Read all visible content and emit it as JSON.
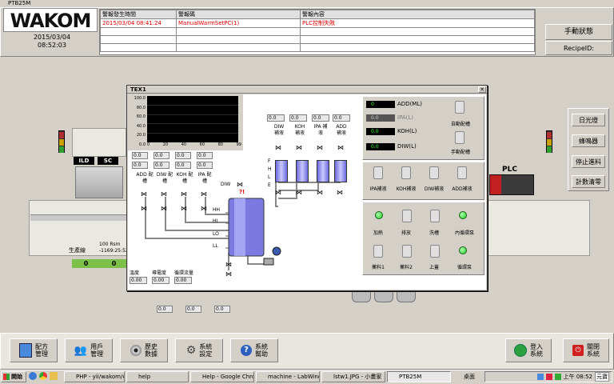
{
  "window": {
    "title": "PTB25M"
  },
  "logo": "WAKOM",
  "datetime": {
    "date": "2015/03/04",
    "time": "08:52:03"
  },
  "alarm": {
    "columns": [
      "警報發生時間",
      "警報碼",
      "警報內容"
    ],
    "rows": [
      [
        "2015/03/04 08:41:24",
        "ManualWarmSetPC(1)",
        "PLC控制失敗"
      ]
    ]
  },
  "top_right": {
    "mode": "手動狀態",
    "recipe_label": "RecipeID:"
  },
  "right_buttons": [
    "日光燈",
    "蜂鳴器",
    "停止進料",
    "計數清零"
  ],
  "plc_label": "PLC",
  "bg": {
    "ild": "ILD",
    "sc": "SC",
    "production_line": "生產線",
    "rpm": "100 Rsm",
    "rpm2": "-1169:25:52",
    "counter_a": "0",
    "counter_b": "0"
  },
  "dialog": {
    "title": "TEX1",
    "chart_ylabels": [
      "100.0",
      "80.0",
      "60.0",
      "40.0",
      "20.0",
      "0.0"
    ],
    "chart_xlabels": [
      "0",
      "20",
      "40",
      "60",
      "80",
      "99"
    ],
    "left_values": [
      "0.0",
      "0.0",
      "0.0",
      "0.0",
      "0.0",
      "0.0",
      "0.0",
      "0.0"
    ],
    "valve_labels": [
      "ADD 配槽",
      "DIW 配槽",
      "KOH 配槽",
      "IPA 配槽"
    ],
    "diw_label": "DIW",
    "top_vals": [
      "0.0",
      "0.0",
      "0.0",
      "0.0"
    ],
    "supply_labels": [
      "DIW 補液",
      "KOH 補液",
      "IPA 補液",
      "ADD 補液"
    ],
    "levels_small": [
      "F",
      "H",
      "L",
      "E"
    ],
    "levels_main": [
      "HH",
      "HI",
      "LO",
      "LL"
    ],
    "bottom_labels": [
      "溫度",
      "導電度",
      "循環流量"
    ],
    "bottom_vals": [
      "0.00",
      "0.00",
      "0.00"
    ],
    "bottom_vals2": [
      "0.0",
      "0.0",
      "0.0"
    ],
    "readouts": [
      {
        "value": "0",
        "label": "ADD(ML)"
      },
      {
        "value": "0.0",
        "label": "IPA(L)"
      },
      {
        "value": "0.0",
        "label": "KOH(L)"
      },
      {
        "value": "0.0",
        "label": "DIW(L)"
      }
    ],
    "switch_auto": "自動配槽",
    "switch_manual": "手動配槽",
    "refill_labels": [
      "IPA補液",
      "KOH補液",
      "DIW補液",
      "ADD補液"
    ],
    "controls_row1": [
      "加熱",
      "排放",
      "洗槽",
      "內循環泵"
    ],
    "controls_row2": [
      "藥料1",
      "藥料2",
      "上蓋",
      "循環泵"
    ],
    "led_colors": {
      "on": "#22cc22",
      "off": "#c8c8c8"
    }
  },
  "toolbar": [
    {
      "label": "配方\n管理",
      "icon": "recipe-icon"
    },
    {
      "label": "用戶\n管理",
      "icon": "users-icon"
    },
    {
      "label": "歷史\n數據",
      "icon": "history-icon"
    },
    {
      "label": "系統\n設定",
      "icon": "settings-icon"
    },
    {
      "label": "系統\n幫助",
      "icon": "help-icon"
    }
  ],
  "login": {
    "label": "登入\n系統"
  },
  "shutdown": {
    "label": "關閉\n系統"
  },
  "taskbar": {
    "start": "開始",
    "tasks": [
      "PHP - yii/wakom/we...",
      "help",
      "Help - Google Chro...",
      "machine - LabWind...",
      "lstw1.JPG - 小畫家",
      "PTB25M"
    ],
    "desktop": "桌面",
    "clock": "上午 08:52",
    "ime": "元寶"
  }
}
